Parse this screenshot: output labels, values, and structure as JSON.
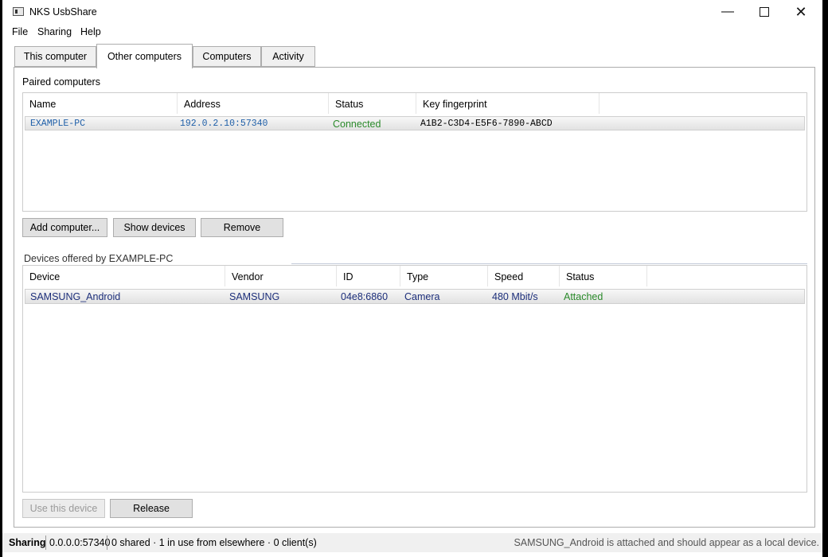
{
  "window": {
    "title": "NKS UsbShare"
  },
  "menu": [
    "File",
    "Sharing",
    "Help"
  ],
  "tabs": [
    "This computer",
    "Other computers",
    "Computers",
    "Activity"
  ],
  "paired": {
    "label": "Paired computers",
    "columns": [
      "Name",
      "Address",
      "Status",
      "Key fingerprint"
    ],
    "rows": [
      {
        "name": "EXAMPLE-PC",
        "address": "192.0.2.10:57340",
        "status": "Connected",
        "fingerprint": "A1B2-C3D4-E5F6-7890-ABCD"
      }
    ]
  },
  "buttons": {
    "add": "Add computer...",
    "show": "Show devices",
    "remove": "Remove",
    "use": "Use this device",
    "release": "Release"
  },
  "devices": {
    "label": "Devices offered by EXAMPLE-PC",
    "columns": [
      "Device",
      "Vendor",
      "ID",
      "Type",
      "Speed",
      "Status"
    ],
    "rows": [
      {
        "device": "SAMSUNG_Android",
        "vendor": "SAMSUNG",
        "id": "04e8:6860",
        "type": "Camera",
        "speed": "480 Mbit/s",
        "status": "Attached"
      }
    ]
  },
  "status": {
    "mode": "Sharing",
    "endpoint": "0.0.0.0:57340",
    "summary": "0 shared · 1 in use from elsewhere · 0 client(s)",
    "message": "SAMSUNG_Android is attached and should appear as a local device."
  }
}
